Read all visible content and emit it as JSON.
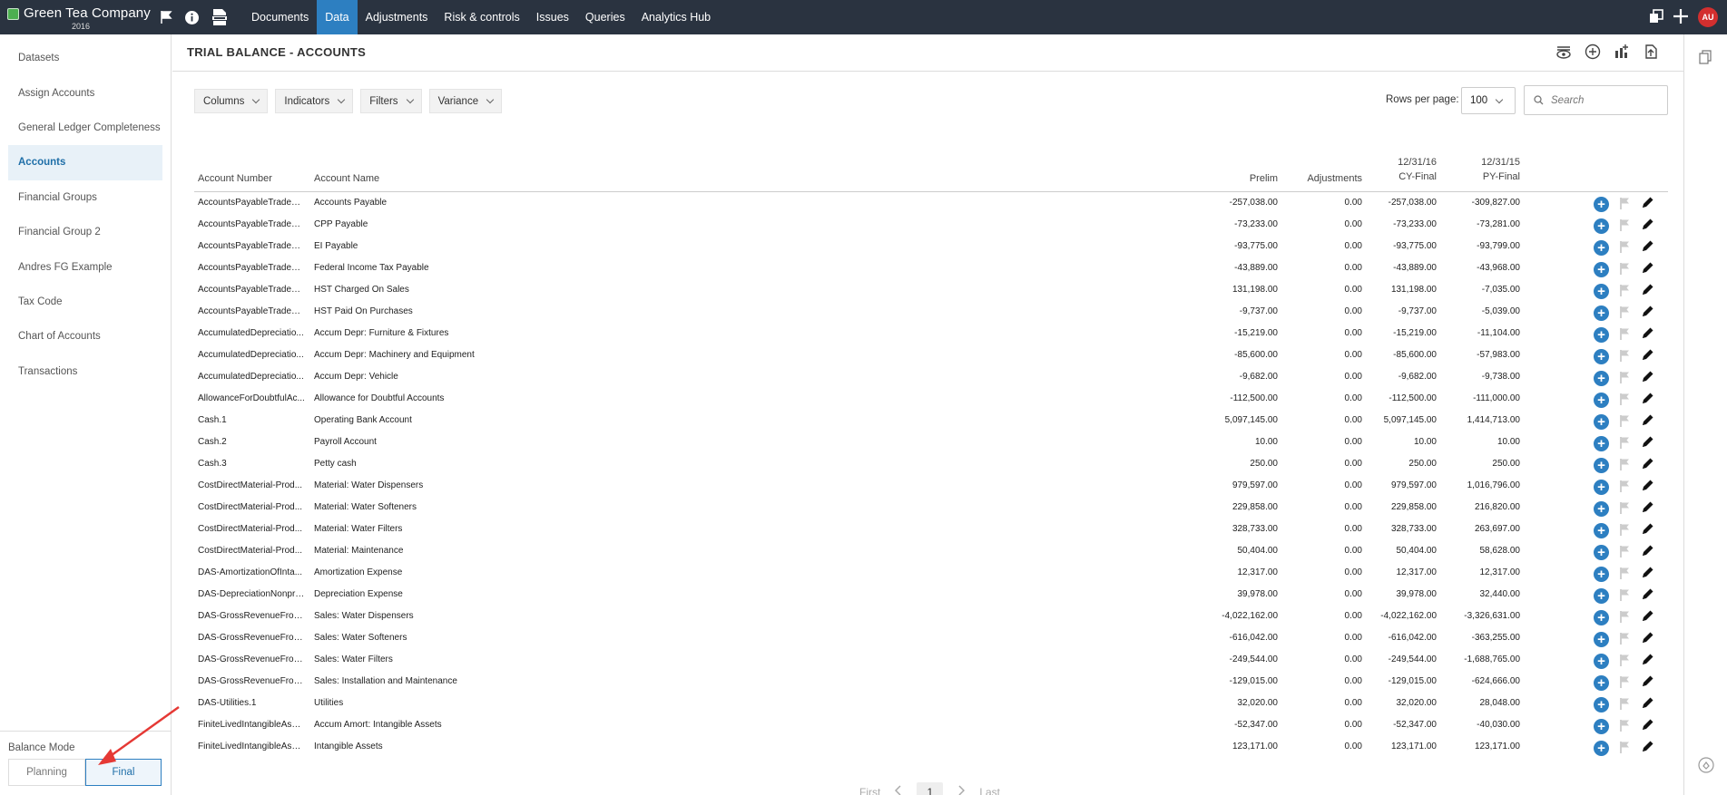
{
  "app": {
    "company": "Green Tea Company",
    "year": "2016",
    "avatar": "AU",
    "accent": "#2d7fc1"
  },
  "nav": [
    {
      "label": "Documents"
    },
    {
      "label": "Data",
      "active": true
    },
    {
      "label": "Adjustments"
    },
    {
      "label": "Risk & controls"
    },
    {
      "label": "Issues"
    },
    {
      "label": "Queries"
    },
    {
      "label": "Analytics Hub"
    }
  ],
  "sidebar": {
    "items": [
      {
        "label": "Datasets"
      },
      {
        "label": "Assign Accounts"
      },
      {
        "label": "General Ledger Completeness"
      },
      {
        "label": "Accounts",
        "active": true
      },
      {
        "label": "Financial Groups"
      },
      {
        "label": "Financial Group 2"
      },
      {
        "label": "Andres FG Example"
      },
      {
        "label": "Tax Code"
      },
      {
        "label": "Chart of Accounts"
      },
      {
        "label": "Transactions"
      }
    ],
    "balance_mode_label": "Balance Mode",
    "planning_label": "Planning",
    "final_label": "Final"
  },
  "main": {
    "title": "TRIAL BALANCE - ACCOUNTS",
    "toolbar": {
      "columns": "Columns",
      "indicators": "Indicators",
      "filters": "Filters",
      "variance": "Variance"
    },
    "rows_per_page_label": "Rows per page:",
    "rows_per_page_value": "100",
    "search_placeholder": "Search"
  },
  "table": {
    "headers": {
      "account_number": "Account Number",
      "account_name": "Account Name",
      "prelim": "Prelim",
      "adjustments": "Adjustments",
      "cy_date": "12/31/16",
      "cy_final": "CY-Final",
      "py_date": "12/31/15",
      "py_final": "PY-Final"
    },
    "rows": [
      {
        "num": "AccountsPayableTradeCu...",
        "name": "Accounts Payable",
        "prelim": "-257,038.00",
        "adj": "0.00",
        "cy": "-257,038.00",
        "py": "-309,827.00"
      },
      {
        "num": "AccountsPayableTradeCu...",
        "name": "CPP Payable",
        "prelim": "-73,233.00",
        "adj": "0.00",
        "cy": "-73,233.00",
        "py": "-73,281.00"
      },
      {
        "num": "AccountsPayableTradeCu...",
        "name": "EI Payable",
        "prelim": "-93,775.00",
        "adj": "0.00",
        "cy": "-93,775.00",
        "py": "-93,799.00"
      },
      {
        "num": "AccountsPayableTradeCu...",
        "name": "Federal Income Tax Payable",
        "prelim": "-43,889.00",
        "adj": "0.00",
        "cy": "-43,889.00",
        "py": "-43,968.00"
      },
      {
        "num": "AccountsPayableTradeCu...",
        "name": "HST Charged On Sales",
        "prelim": "131,198.00",
        "adj": "0.00",
        "cy": "131,198.00",
        "py": "-7,035.00"
      },
      {
        "num": "AccountsPayableTradeCu...",
        "name": "HST Paid On Purchases",
        "prelim": "-9,737.00",
        "adj": "0.00",
        "cy": "-9,737.00",
        "py": "-5,039.00"
      },
      {
        "num": "AccumulatedDepreciatio...",
        "name": "Accum Depr: Furniture & Fixtures",
        "prelim": "-15,219.00",
        "adj": "0.00",
        "cy": "-15,219.00",
        "py": "-11,104.00"
      },
      {
        "num": "AccumulatedDepreciatio...",
        "name": "Accum Depr: Machinery and Equipment",
        "prelim": "-85,600.00",
        "adj": "0.00",
        "cy": "-85,600.00",
        "py": "-57,983.00"
      },
      {
        "num": "AccumulatedDepreciatio...",
        "name": "Accum Depr: Vehicle",
        "prelim": "-9,682.00",
        "adj": "0.00",
        "cy": "-9,682.00",
        "py": "-9,738.00"
      },
      {
        "num": "AllowanceForDoubtfulAc...",
        "name": "Allowance for Doubtful Accounts",
        "prelim": "-112,500.00",
        "adj": "0.00",
        "cy": "-112,500.00",
        "py": "-111,000.00"
      },
      {
        "num": "Cash.1",
        "name": "Operating Bank Account",
        "prelim": "5,097,145.00",
        "adj": "0.00",
        "cy": "5,097,145.00",
        "py": "1,414,713.00"
      },
      {
        "num": "Cash.2",
        "name": "Payroll Account",
        "prelim": "10.00",
        "adj": "0.00",
        "cy": "10.00",
        "py": "10.00"
      },
      {
        "num": "Cash.3",
        "name": "Petty cash",
        "prelim": "250.00",
        "adj": "0.00",
        "cy": "250.00",
        "py": "250.00"
      },
      {
        "num": "CostDirectMaterial-Prod...",
        "name": "Material: Water Dispensers",
        "prelim": "979,597.00",
        "adj": "0.00",
        "cy": "979,597.00",
        "py": "1,016,796.00"
      },
      {
        "num": "CostDirectMaterial-Prod...",
        "name": "Material: Water Softeners",
        "prelim": "229,858.00",
        "adj": "0.00",
        "cy": "229,858.00",
        "py": "216,820.00"
      },
      {
        "num": "CostDirectMaterial-Prod...",
        "name": "Material: Water Filters",
        "prelim": "328,733.00",
        "adj": "0.00",
        "cy": "328,733.00",
        "py": "263,697.00"
      },
      {
        "num": "CostDirectMaterial-Prod...",
        "name": "Material: Maintenance",
        "prelim": "50,404.00",
        "adj": "0.00",
        "cy": "50,404.00",
        "py": "58,628.00"
      },
      {
        "num": "DAS-AmortizationOfIntа...",
        "name": "Amortization Expense",
        "prelim": "12,317.00",
        "adj": "0.00",
        "cy": "12,317.00",
        "py": "12,317.00"
      },
      {
        "num": "DAS-DepreciationNonpro...",
        "name": "Depreciation Expense",
        "prelim": "39,978.00",
        "adj": "0.00",
        "cy": "39,978.00",
        "py": "32,440.00"
      },
      {
        "num": "DAS-GrossRevenueFrom...",
        "name": "Sales: Water Dispensers",
        "prelim": "-4,022,162.00",
        "adj": "0.00",
        "cy": "-4,022,162.00",
        "py": "-3,326,631.00"
      },
      {
        "num": "DAS-GrossRevenueFrom...",
        "name": "Sales: Water Softeners",
        "prelim": "-616,042.00",
        "adj": "0.00",
        "cy": "-616,042.00",
        "py": "-363,255.00"
      },
      {
        "num": "DAS-GrossRevenueFrom...",
        "name": "Sales: Water Filters",
        "prelim": "-249,544.00",
        "adj": "0.00",
        "cy": "-249,544.00",
        "py": "-1,688,765.00"
      },
      {
        "num": "DAS-GrossRevenueFrom...",
        "name": "Sales: Installation and Maintenance",
        "prelim": "-129,015.00",
        "adj": "0.00",
        "cy": "-129,015.00",
        "py": "-624,666.00"
      },
      {
        "num": "DAS-Utilities.1",
        "name": "Utilities",
        "prelim": "32,020.00",
        "adj": "0.00",
        "cy": "32,020.00",
        "py": "28,048.00"
      },
      {
        "num": "FiniteLivedIntangibleAsse...",
        "name": "Accum Amort: Intangible Assets",
        "prelim": "-52,347.00",
        "adj": "0.00",
        "cy": "-52,347.00",
        "py": "-40,030.00"
      },
      {
        "num": "FiniteLivedIntangibleAsse...",
        "name": "Intangible Assets",
        "prelim": "123,171.00",
        "adj": "0.00",
        "cy": "123,171.00",
        "py": "123,171.00"
      }
    ],
    "row_add_label": "+"
  },
  "pager": {
    "first": "First",
    "page": "1",
    "last": "Last"
  }
}
